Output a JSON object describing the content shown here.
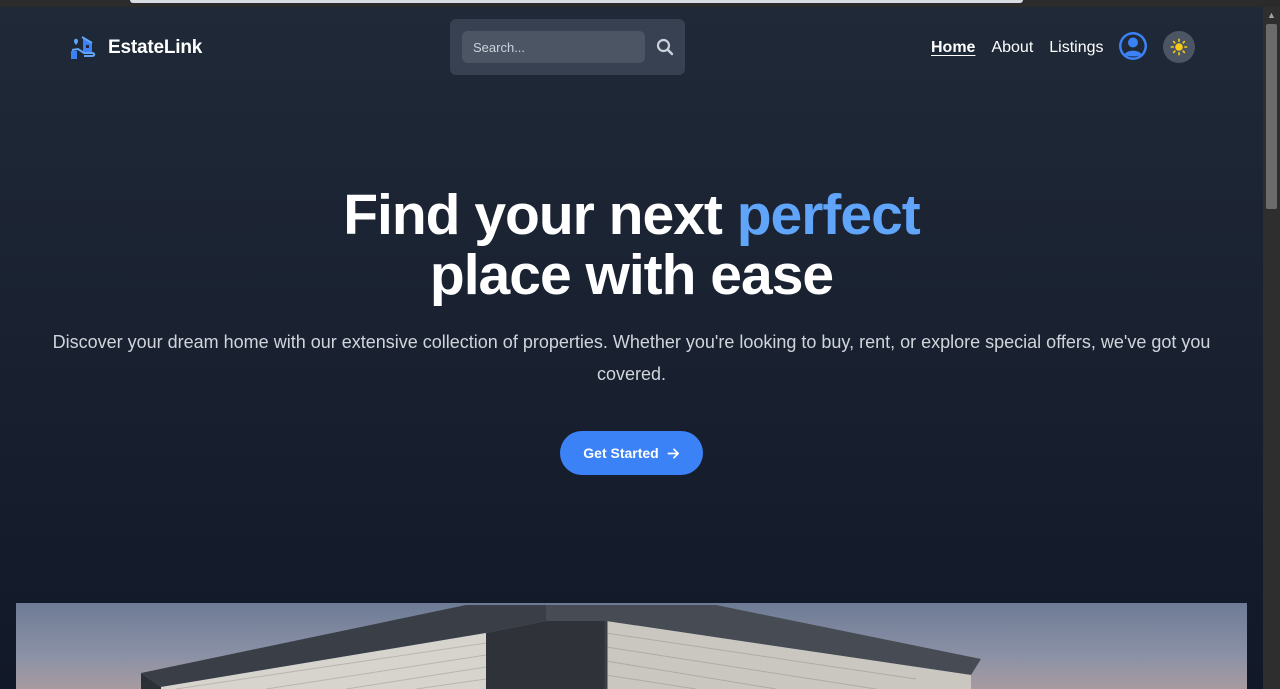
{
  "header": {
    "brand": "EstateLink",
    "search_placeholder": "Search...",
    "nav": [
      {
        "label": "Home",
        "active": true
      },
      {
        "label": "About",
        "active": false
      },
      {
        "label": "Listings",
        "active": false
      }
    ]
  },
  "hero": {
    "title_part1": "Find your next ",
    "title_accent": "perfect",
    "title_part2": "place with ease",
    "subtitle": "Discover your dream home with our extensive collection of properties. Whether you're looking to buy, rent, or explore special offers, we've got you covered.",
    "cta_label": "Get Started"
  },
  "colors": {
    "accent": "#60a5fa",
    "button": "#3b82f6",
    "background": "#1f2937"
  },
  "icons": [
    "logo-house-hand-icon",
    "search-icon",
    "user-circle-icon",
    "sun-icon",
    "arrow-right-icon"
  ]
}
